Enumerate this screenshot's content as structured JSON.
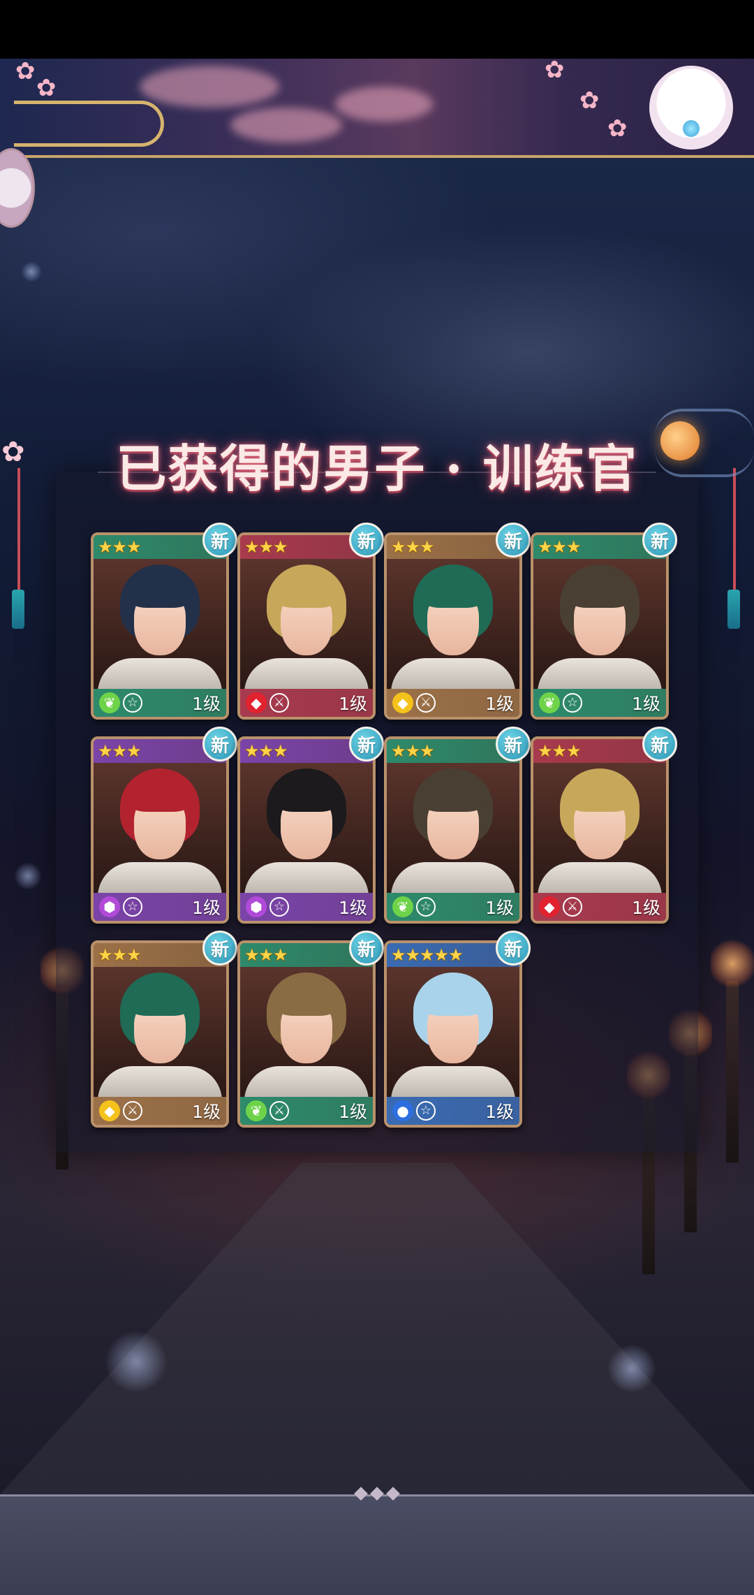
{
  "header": {
    "title": "已获得的男子 · 训练官"
  },
  "badge_new_label": "新",
  "colors": {
    "green": "#2d8a6b",
    "red": "#a83a4e",
    "tan": "#9c7148",
    "purple": "#7a44a8",
    "blue": "#3a6bb3",
    "new_badge": "#3fb2cc",
    "card_border": "#b9916b",
    "star": "#ffd447"
  },
  "cards": [
    {
      "stars": "★★★",
      "top_color": "green",
      "bottom_color": "green",
      "element": "leaf-icon",
      "role": "pentagram-icon",
      "level": "1级",
      "hair": "#22304a"
    },
    {
      "stars": "★★★",
      "top_color": "red",
      "bottom_color": "red",
      "element": "flame-icon",
      "role": "swords-icon",
      "level": "1级",
      "hair": "#c7a75a"
    },
    {
      "stars": "★★★",
      "top_color": "tan",
      "bottom_color": "tan",
      "element": "diamond-icon",
      "role": "swords-icon",
      "level": "1级",
      "hair": "#1f6b56"
    },
    {
      "stars": "★★★",
      "top_color": "green",
      "bottom_color": "green",
      "element": "leaf-icon",
      "role": "pentagram-icon",
      "level": "1级",
      "hair": "#4a3f33"
    },
    {
      "stars": "★★★",
      "top_color": "purple",
      "bottom_color": "purple",
      "element": "crystal-icon",
      "role": "pentagram-icon",
      "level": "1级",
      "hair": "#b3232f"
    },
    {
      "stars": "★★★",
      "top_color": "purple",
      "bottom_color": "purple",
      "element": "crystal-icon",
      "role": "pentagram-icon",
      "level": "1级",
      "hair": "#1c1a1c"
    },
    {
      "stars": "★★★",
      "top_color": "green",
      "bottom_color": "green",
      "element": "leaf-icon",
      "role": "pentagram-icon",
      "level": "1级",
      "hair": "#4a3f33"
    },
    {
      "stars": "★★★",
      "top_color": "red",
      "bottom_color": "red",
      "element": "flame-icon",
      "role": "swords-icon",
      "level": "1级",
      "hair": "#c7a75a"
    },
    {
      "stars": "★★★",
      "top_color": "tan",
      "bottom_color": "tan",
      "element": "diamond-icon",
      "role": "swords-icon",
      "level": "1级",
      "hair": "#1f6b56"
    },
    {
      "stars": "★★★",
      "top_color": "green",
      "bottom_color": "green",
      "element": "leaf-icon",
      "role": "swords-icon",
      "level": "1级",
      "hair": "#8a6c44"
    },
    {
      "stars": "★★★★★",
      "top_color": "blue",
      "bottom_color": "blue",
      "element": "water-icon",
      "role": "pentagram-icon",
      "level": "1级",
      "hair": "#a9d3ea"
    }
  ]
}
